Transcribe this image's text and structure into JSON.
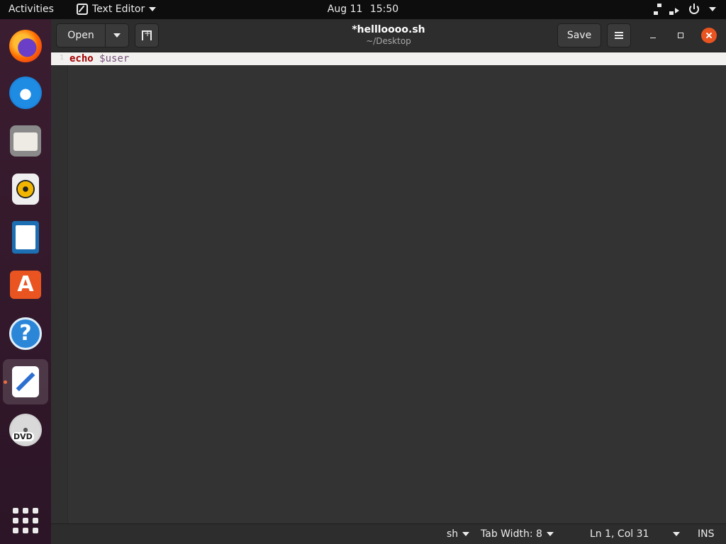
{
  "topbar": {
    "activities": "Activities",
    "app_name": "Text Editor",
    "date": "Aug 11",
    "time": "15:50",
    "tray_icons": [
      "network-icon",
      "volume-icon",
      "power-icon"
    ]
  },
  "dock": {
    "items": [
      {
        "name": "Firefox",
        "icon": "firefox-icon"
      },
      {
        "name": "Thunderbird",
        "icon": "thunderbird-icon"
      },
      {
        "name": "Files",
        "icon": "files-icon"
      },
      {
        "name": "Rhythmbox",
        "icon": "rhythmbox-icon"
      },
      {
        "name": "LibreOffice Writer",
        "icon": "writer-icon"
      },
      {
        "name": "Ubuntu Software",
        "icon": "software-store-icon",
        "glyph": "A"
      },
      {
        "name": "Help",
        "icon": "help-icon",
        "glyph": "?"
      },
      {
        "name": "Text Editor",
        "icon": "text-editor-icon",
        "active": true
      },
      {
        "name": "DVD",
        "icon": "dvd-icon",
        "glyph": "DVD"
      }
    ],
    "apps_grid_icon": "show-applications-icon"
  },
  "window": {
    "open_label": "Open",
    "save_label": "Save",
    "title": "*hellloooo.sh",
    "subtitle": "~/Desktop"
  },
  "editor": {
    "line_number": "1",
    "code_keyword": "echo",
    "code_variable": "$user"
  },
  "statusbar": {
    "language": "sh",
    "tab_width": "Tab Width: 8",
    "position": "Ln 1, Col 31",
    "mode": "INS"
  },
  "colors": {
    "accent": "#e95420",
    "keyword": "#a40000",
    "variable": "#75507b",
    "editor_bg": "#333333"
  }
}
